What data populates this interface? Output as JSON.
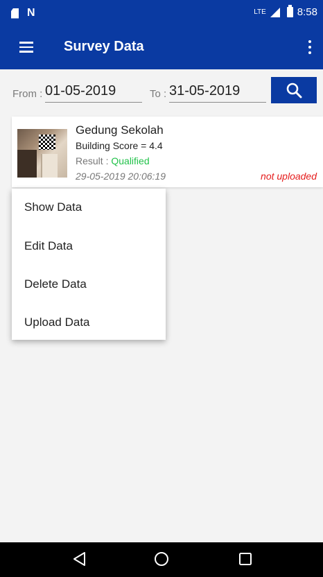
{
  "status_bar": {
    "left_icons": [
      "sd-card-icon",
      "n-notification-icon"
    ],
    "network": "LTE",
    "time": "8:58"
  },
  "app_bar": {
    "title": "Survey Data",
    "menu_icon": "hamburger-menu-icon",
    "overflow_icon": "more-vert-icon"
  },
  "filter": {
    "from_label": "From :",
    "from_value": "01-05-2019",
    "to_label": "To :",
    "to_value": "31-05-2019",
    "search_icon": "search-icon"
  },
  "record": {
    "name": "Gedung Sekolah",
    "score": "Building Score = 4.4",
    "result_label": "Result :",
    "result_value": "Qualified",
    "datetime": "29-05-2019 20:06:19",
    "upload_status": "not uploaded"
  },
  "context_menu": {
    "items": [
      "Show Data",
      "Edit Data",
      "Delete Data",
      "Upload Data"
    ]
  },
  "colors": {
    "primary": "#0a3aa2",
    "qualified": "#22c24a",
    "not_uploaded": "#e51c1c"
  },
  "nav_bar": {
    "buttons": [
      "back-icon",
      "home-icon",
      "recents-icon"
    ]
  }
}
